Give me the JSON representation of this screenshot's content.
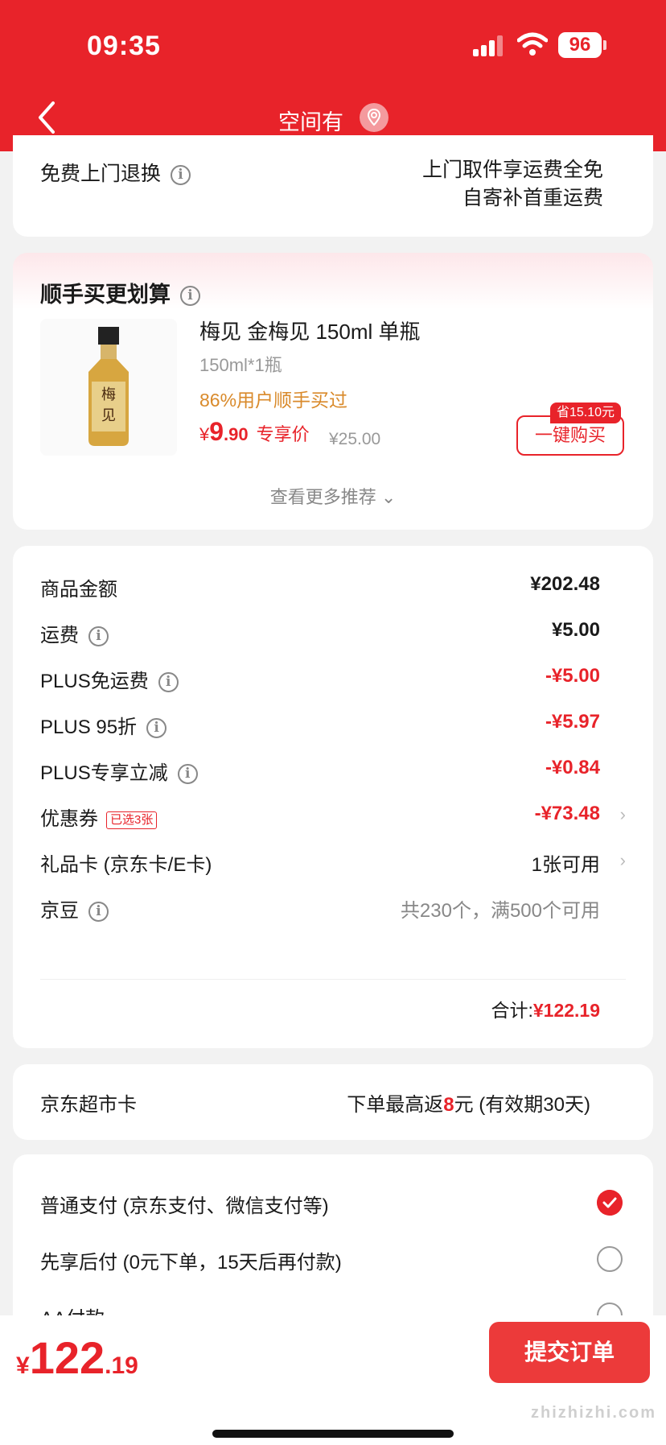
{
  "status": {
    "time": "09:35",
    "battery": "96"
  },
  "nav": {
    "title": "空间有"
  },
  "returns": {
    "label": "免费上门退换",
    "line1": "上门取件享运费全免",
    "line2": "自寄补首重运费"
  },
  "recommend": {
    "title": "顺手买更划算",
    "product_name": "梅见 金梅见 150ml 单瓶",
    "spec": "150ml*1瓶",
    "bought_pct": "86%用户顺手买过",
    "price_currency": "¥",
    "price_int": "9",
    "price_dec": ".90",
    "price_tag": "专享价",
    "orig_price": "¥25.00",
    "save_badge": "省15.10元",
    "buy_button": "一键购买",
    "more_link": "查看更多推荐 ⌄"
  },
  "summary": {
    "rows": [
      {
        "label": "商品金额",
        "value": "¥202.48"
      },
      {
        "label": "运费",
        "value": "¥5.00"
      },
      {
        "label": "PLUS免运费",
        "value": "-¥5.00"
      },
      {
        "label": "PLUS 95折",
        "value": "-¥5.97"
      },
      {
        "label": "PLUS专享立减",
        "value": "-¥0.84"
      },
      {
        "label": "优惠券",
        "value": "-¥73.48",
        "tag": "已选3张"
      },
      {
        "label": "礼品卡 (京东卡/E卡)",
        "value": "1张可用"
      },
      {
        "label": "京豆",
        "value": "共230个，满500个可用"
      }
    ],
    "total_label": "合计:",
    "total_value": "¥122.19"
  },
  "market": {
    "label": "京东超市卡",
    "pre": "下单最高返",
    "amount": "8",
    "post": "元 (有效期30天)"
  },
  "payment": {
    "options": [
      {
        "label": "普通支付 (京东支付、微信支付等)",
        "selected": true
      },
      {
        "label": "先享后付 (0元下单，15天后再付款)",
        "selected": false
      },
      {
        "label": "AA付款",
        "selected": false
      }
    ]
  },
  "bottom": {
    "currency": "¥",
    "int": "122",
    "dec": ".19",
    "submit": "提交订单",
    "watermark": "zhizhizhi.com"
  },
  "colors": {
    "brand": "#e8232a",
    "accent_orange": "#d98a2b"
  }
}
